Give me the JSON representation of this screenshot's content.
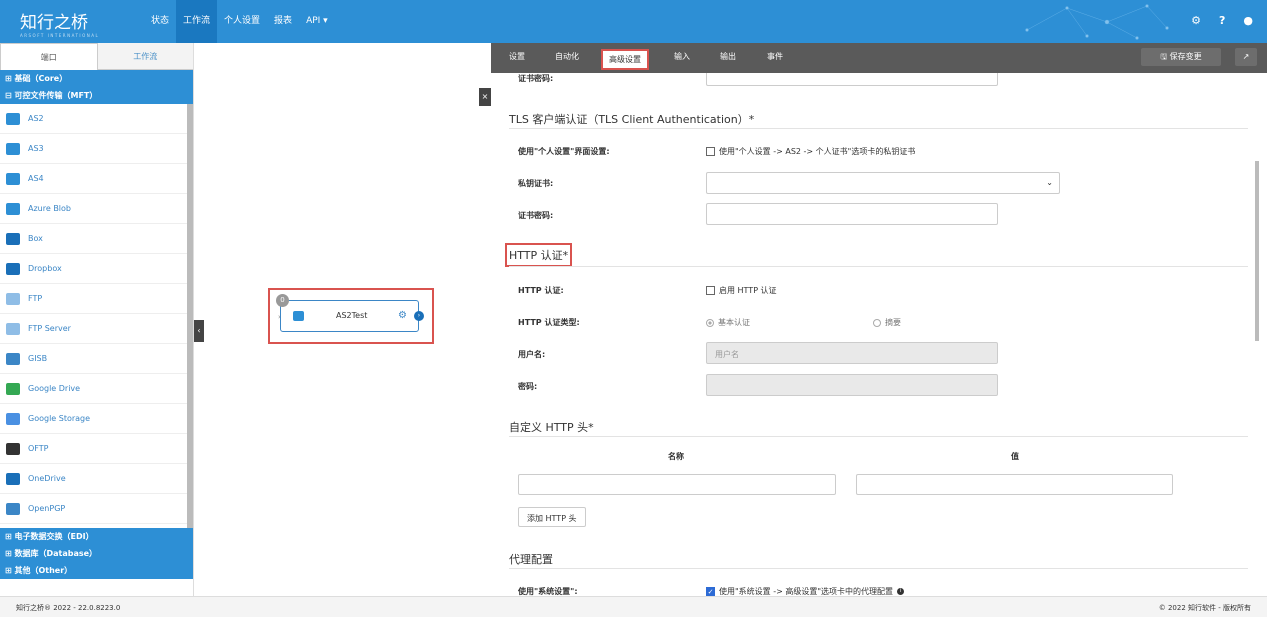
{
  "app": {
    "logo": "知行之桥",
    "logo_sub": "ARSOFT INTERNATIONAL",
    "nav": [
      "状态",
      "工作流",
      "个人设置",
      "报表",
      "API ▾"
    ],
    "active_nav": "工作流",
    "top_icons": [
      "gear-icon",
      "help-icon",
      "user-icon"
    ]
  },
  "left": {
    "tabs": [
      "端口",
      "工作流"
    ],
    "categories_top": [
      "⊞ 基础（Core）",
      "⊟ 可控文件传输（MFT）"
    ],
    "connectors": [
      {
        "label": "AS2",
        "icon": "as2-icon",
        "color": "#2d8fd5"
      },
      {
        "label": "AS3",
        "icon": "as3-icon",
        "color": "#2d8fd5"
      },
      {
        "label": "AS4",
        "icon": "as4-icon",
        "color": "#2d8fd5"
      },
      {
        "label": "Azure Blob",
        "icon": "azure-blob-icon",
        "color": "#2d8fd5"
      },
      {
        "label": "Box",
        "icon": "box-icon",
        "color": "#1a6fb8"
      },
      {
        "label": "Dropbox",
        "icon": "dropbox-icon",
        "color": "#1a6fb8"
      },
      {
        "label": "FTP",
        "icon": "ftp-icon",
        "color": "#8fbde6"
      },
      {
        "label": "FTP Server",
        "icon": "ftp-server-icon",
        "color": "#8fbde6"
      },
      {
        "label": "GISB",
        "icon": "gisb-icon",
        "color": "#3b86c6"
      },
      {
        "label": "Google Drive",
        "icon": "google-drive-icon",
        "color": "#34a853"
      },
      {
        "label": "Google Storage",
        "icon": "google-storage-icon",
        "color": "#4a90e2"
      },
      {
        "label": "OFTP",
        "icon": "oftp-icon",
        "color": "#333333"
      },
      {
        "label": "OneDrive",
        "icon": "onedrive-icon",
        "color": "#1a6fb8"
      },
      {
        "label": "OpenPGP",
        "icon": "openpgp-icon",
        "color": "#3b86c6"
      }
    ],
    "categories_bottom": [
      "⊞ 电子数据交换（EDI）",
      "⊞ 数据库（Database）",
      "⊞ 其他（Other）"
    ]
  },
  "canvas": {
    "node_label": "AS2Test",
    "node_badge": "0",
    "collapse": "‹",
    "close": "×"
  },
  "panel": {
    "tabs": [
      "设置",
      "自动化",
      "高级设置",
      "输入",
      "输出",
      "事件"
    ],
    "active_tab": "高级设置",
    "save_label": "🖫 保存变更",
    "external_label": "↗",
    "cert_password_top_label": "证书密码:",
    "tls_section": "TLS 客户端认证（TLS Client Authentication）*",
    "tls_use_profile_label": "使用\"个人设置\"界面设置:",
    "tls_use_profile_check": "使用\"个人设置 -> AS2 -> 个人证书\"选项卡的私钥证书",
    "private_cert_label": "私钥证书:",
    "cert_password_label": "证书密码:",
    "http_section": "HTTP 认证*",
    "http_auth_label": "HTTP 认证:",
    "http_auth_check": "启用 HTTP 认证",
    "http_auth_type_label": "HTTP 认证类型:",
    "http_auth_basic": "基本认证",
    "http_auth_digest": "摘要",
    "username_label": "用户名:",
    "username_placeholder": "用户名",
    "password_label": "密码:",
    "custom_headers_section": "自定义 HTTP 头*",
    "col_name": "名称",
    "col_value": "值",
    "add_header_btn": "添加 HTTP 头",
    "proxy_section": "代理配置",
    "proxy_use_system_label": "使用\"系统设置\":",
    "proxy_use_system_check": "使用\"系统设置 -> 高级设置\"选项卡中的代理配置"
  },
  "footer": {
    "left": "知行之桥® 2022 - 22.0.8223.0",
    "right": "© 2022 知行软件 - 版权所有"
  }
}
